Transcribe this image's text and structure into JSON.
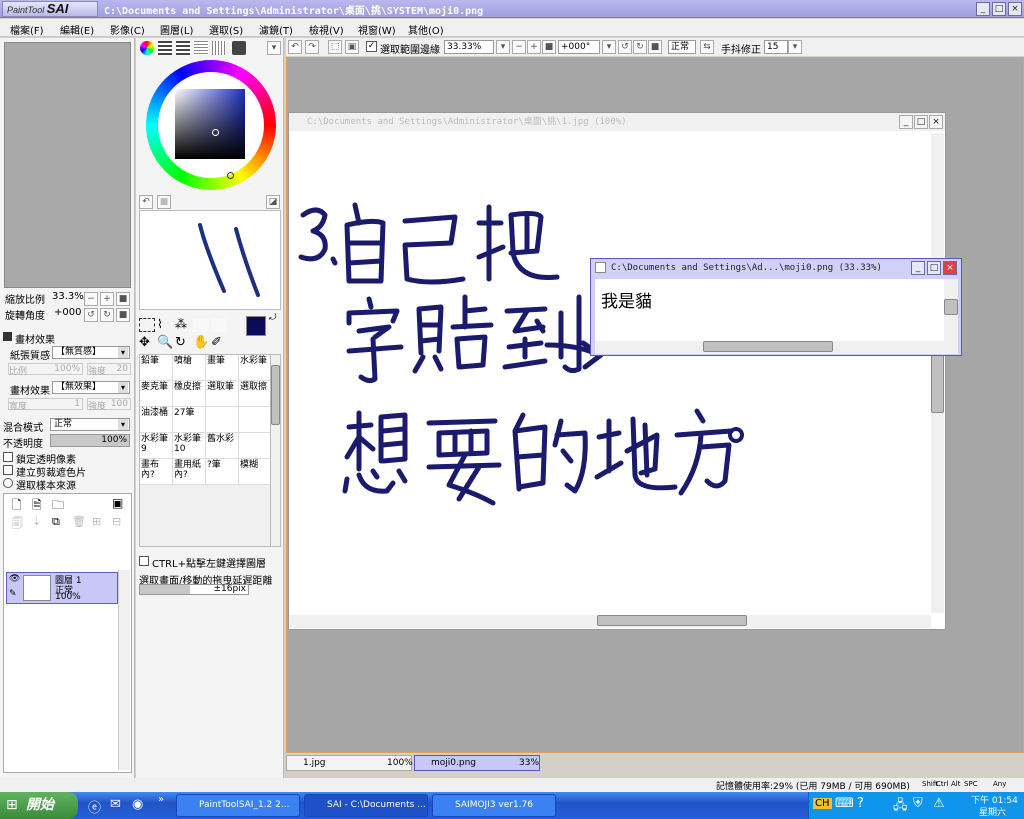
{
  "titlebar": {
    "app_logo_small": "PaintTool",
    "app_logo_big": "SAI",
    "path": "C:\\Documents and Settings\\Administrator\\桌面\\挑\\SYSTEM\\moji0.png"
  },
  "menu": [
    "檔案(F)",
    "編輯(E)",
    "影像(C)",
    "圖層(L)",
    "選取(S)",
    "濾鏡(T)",
    "檢視(V)",
    "視窗(W)",
    "其他(O)"
  ],
  "toolbar": {
    "select_edge": "選取範圍邊緣",
    "zoom": "33.33%",
    "rotate": "+000°",
    "blend": "正常",
    "stabilizer_label": "手抖修正",
    "stabilizer": "15"
  },
  "nav": {
    "zoom_label": "縮放比例",
    "zoom_value": "33.3%",
    "rotate_label": "旋轉角度",
    "rotate_value": "+000"
  },
  "paint_effects": {
    "header": "畫材效果",
    "paper_label": "紙張質感",
    "paper_value": "【無質感】",
    "scale_label": "比例",
    "scale_value": "100%",
    "strength_label": "強度",
    "strength_value": "20",
    "brush_label": "畫材效果",
    "brush_value": "【無效果】",
    "width_label": "寬度",
    "width_value": "1",
    "strength2_label": "強度",
    "strength2_value": "100"
  },
  "layer_props": {
    "blend_label": "混合模式",
    "blend_value": "正常",
    "opacity_label": "不透明度",
    "opacity_value": "100%",
    "opacity_fraction": 1.0,
    "lock_alpha": "鎖定透明像素",
    "clip_group": "建立剪裁遮色片",
    "sample_source": "選取樣本來源"
  },
  "layer": {
    "name": "圖層 1",
    "mode": "正常",
    "opacity": "100%"
  },
  "brushes": [
    [
      "鉛筆",
      "噴槍",
      "畫筆",
      "水彩筆"
    ],
    [
      "麥克筆",
      "橡皮擦",
      "選取筆",
      "選取擦"
    ],
    [
      "油漆桶",
      "27筆",
      "",
      ""
    ],
    [
      "水彩筆 9",
      "水彩筆 10",
      "舊水彩",
      ""
    ],
    [
      "畫布內?",
      "畫用紙內?",
      "?筆",
      "模糊"
    ]
  ],
  "tool_opts": {
    "ctrl_hint": "CTRL+點擊左鍵選擇圖層",
    "delay_label": "選取畫面/移動的拖曳延遲距離",
    "delay_value": "±16pix"
  },
  "doc1": {
    "title": "C:\\Documents and Settings\\Administrator\\桌面\\挑\\1.jpg (100%)"
  },
  "doc2": {
    "title": "C:\\Documents and Settings\\Ad...\\moji0.png (33.33%)",
    "content": "我是貓"
  },
  "tabs": [
    {
      "name": "1.jpg",
      "zoom": "100%"
    },
    {
      "name": "moji0.png",
      "zoom": "33%"
    }
  ],
  "status": {
    "memory": "記憶體使用率:29% (已用 79MB / 可用 690MB)",
    "keys": [
      "Shift",
      "Ctrl",
      "Alt",
      "SPC",
      "Any"
    ]
  },
  "taskbar": {
    "start": "開始",
    "tasks": [
      "PaintToolSAI_1.2 2...",
      "SAI - C:\\Documents ...",
      "SAIMOJI3 ver1.76"
    ],
    "ime": "CH",
    "clock": "下午 01:54",
    "day": "星期六"
  },
  "colors": {
    "accent": "#9f9fe0",
    "current_color": "#0b0b5a",
    "ink": "#1b1b6e"
  }
}
